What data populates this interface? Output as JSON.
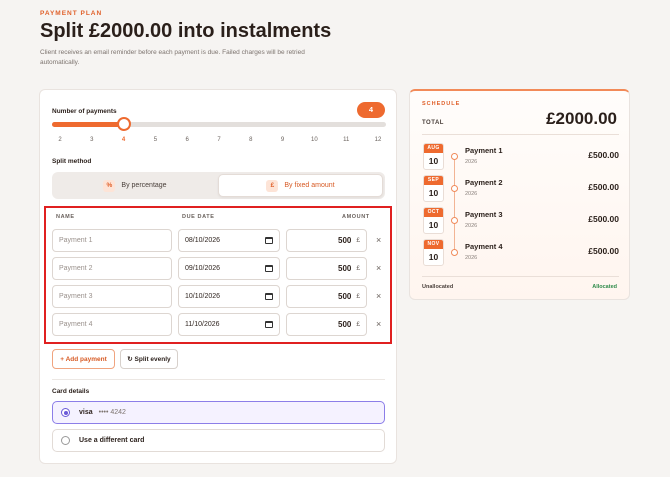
{
  "header": {
    "eyebrow": "PAYMENT PLAN",
    "title": "Split £2000.00 into instalments",
    "subtitle": "Client receives an email reminder before each payment is due. Failed charges will be retried automatically."
  },
  "payments_count": {
    "label": "Number of payments",
    "value": "4",
    "slider_fraction": 0.2,
    "ticks": [
      "2",
      "3",
      "4",
      "5",
      "6",
      "7",
      "8",
      "9",
      "10",
      "11",
      "12"
    ],
    "active_tick": "4"
  },
  "split_method": {
    "label": "Split method",
    "options": [
      {
        "icon": "%",
        "label": "By percentage"
      },
      {
        "icon": "£",
        "label": "By fixed amount"
      }
    ],
    "selected": "By fixed amount"
  },
  "table": {
    "headers": {
      "name": "NAME",
      "due_date": "DUE DATE",
      "amount": "AMOUNT"
    },
    "rows": [
      {
        "name_placeholder": "Payment 1",
        "due_date": "08/10/2026",
        "amount": "500",
        "currency": "£"
      },
      {
        "name_placeholder": "Payment 2",
        "due_date": "09/10/2026",
        "amount": "500",
        "currency": "£"
      },
      {
        "name_placeholder": "Payment 3",
        "due_date": "10/10/2026",
        "amount": "500",
        "currency": "£"
      },
      {
        "name_placeholder": "Payment 4",
        "due_date": "11/10/2026",
        "amount": "500",
        "currency": "£"
      }
    ],
    "remove_symbol": "×"
  },
  "actions": {
    "add_payment": "+ Add payment",
    "split_evenly": "↻ Split evenly"
  },
  "card_details": {
    "label": "Card details",
    "saved_card": {
      "brand": "visa",
      "masked": "•••• 4242",
      "selected": true
    },
    "other_option": "Use a different card"
  },
  "schedule": {
    "eyebrow": "SCHEDULE",
    "total_label": "TOTAL",
    "total_value": "£2000.00",
    "items": [
      {
        "month": "AUG",
        "day": "10",
        "name": "Payment 1",
        "year": "2026",
        "amount": "£500.00"
      },
      {
        "month": "SEP",
        "day": "10",
        "name": "Payment 2",
        "year": "2026",
        "amount": "£500.00"
      },
      {
        "month": "OCT",
        "day": "10",
        "name": "Payment 3",
        "year": "2026",
        "amount": "£500.00"
      },
      {
        "month": "NOV",
        "day": "10",
        "name": "Payment 4",
        "year": "2026",
        "amount": "£500.00"
      }
    ],
    "unallocated_label": "Unallocated",
    "allocated_label": "Allocated"
  },
  "colors": {
    "accent": "#ee6a2f",
    "highlight_border": "#e02020",
    "selected_card_border": "#8c7ee8",
    "allocated_green": "#2e8b4a"
  }
}
